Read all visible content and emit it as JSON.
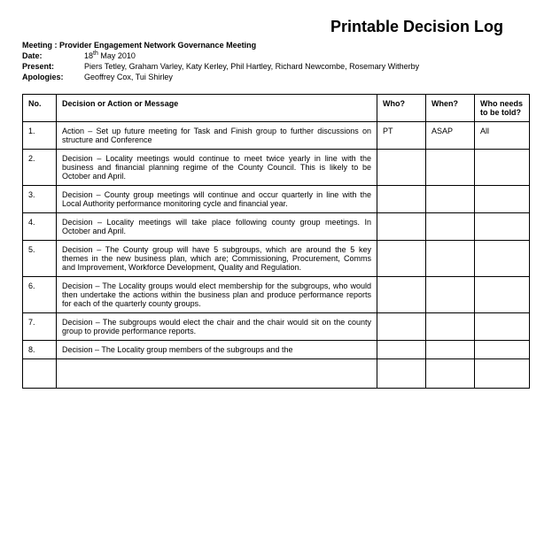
{
  "title": "Printable Decision Log",
  "meta": {
    "meeting_label": "Meeting :",
    "meeting_value": "Provider Engagement Network Governance Meeting",
    "date_label": "Date:",
    "date_day": "18",
    "date_ord": "th",
    "date_rest": " May 2010",
    "present_label": "Present:",
    "present_value": "Piers Tetley, Graham Varley, Katy Kerley, Phil Hartley, Richard Newcombe, Rosemary Witherby",
    "apologies_label": "Apologies:",
    "apologies_value": "Geoffrey Cox, Tui Shirley"
  },
  "headers": {
    "no": "No.",
    "desc": "Decision or Action or Message",
    "who": "Who?",
    "when": "When?",
    "told": "Who needs to be told?"
  },
  "rows": [
    {
      "no": "1.",
      "desc": "Action – Set up future meeting for Task and Finish group to further discussions on structure and Conference",
      "who": "PT",
      "when": "ASAP",
      "told": "All"
    },
    {
      "no": "2.",
      "desc": "Decision – Locality meetings would continue to meet twice yearly in line with the business and financial planning regime of the County Council.  This is likely to be October and April.",
      "who": "",
      "when": "",
      "told": ""
    },
    {
      "no": "3.",
      "desc": "Decision – County group meetings will continue and occur quarterly in line with the Local Authority performance monitoring cycle and financial year.",
      "who": "",
      "when": "",
      "told": ""
    },
    {
      "no": "4.",
      "desc": "Decision – Locality meetings will take place following county group meetings. In October and April.",
      "who": "",
      "when": "",
      "told": ""
    },
    {
      "no": "5.",
      "desc": "Decision – The County group will have 5 subgroups, which are around the 5 key themes in the new business plan, which are; Commissioning, Procurement, Comms and Improvement, Workforce Development, Quality and Regulation.",
      "who": "",
      "when": "",
      "told": ""
    },
    {
      "no": "6.",
      "desc": "Decision – The Locality groups would elect membership for the subgroups, who would then undertake the actions within the business plan and produce performance reports for each of the quarterly county groups.",
      "who": "",
      "when": "",
      "told": ""
    },
    {
      "no": "7.",
      "desc": "Decision – The subgroups would elect the chair and the chair would sit on the county group to provide performance reports.",
      "who": "",
      "when": "",
      "told": ""
    },
    {
      "no": "8.",
      "desc": "Decision – The Locality group members of the subgroups and the",
      "who": "",
      "when": "",
      "told": ""
    },
    {
      "no": "",
      "desc": "",
      "who": "",
      "when": "",
      "told": ""
    }
  ]
}
